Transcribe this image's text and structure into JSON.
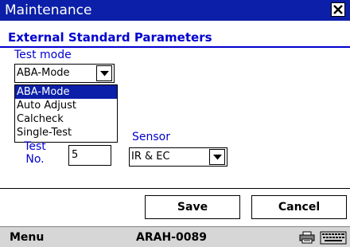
{
  "window": {
    "title": "Maintenance",
    "close_icon": "close-icon",
    "titlebar_color": "#0b1fa8"
  },
  "section": {
    "title": "External Standard Parameters",
    "accent_color": "#0000d0"
  },
  "test_mode": {
    "label": "Test mode",
    "value": "ABA-Mode",
    "options": [
      "ABA-Mode",
      "Auto Adjust",
      "Calcheck",
      "Single-Test"
    ],
    "selected_option": "ABA-Mode",
    "dropdown_open": true
  },
  "test_no": {
    "label_line1": "Test",
    "label_line2": "No.",
    "value": "5"
  },
  "sensor": {
    "label": "Sensor",
    "value": "IR & EC"
  },
  "buttons": {
    "save": "Save",
    "cancel": "Cancel"
  },
  "menubar": {
    "menu_label": "Menu",
    "device_id": "ARAH-0089",
    "icons": [
      "printer-icon",
      "keyboard-icon"
    ]
  }
}
